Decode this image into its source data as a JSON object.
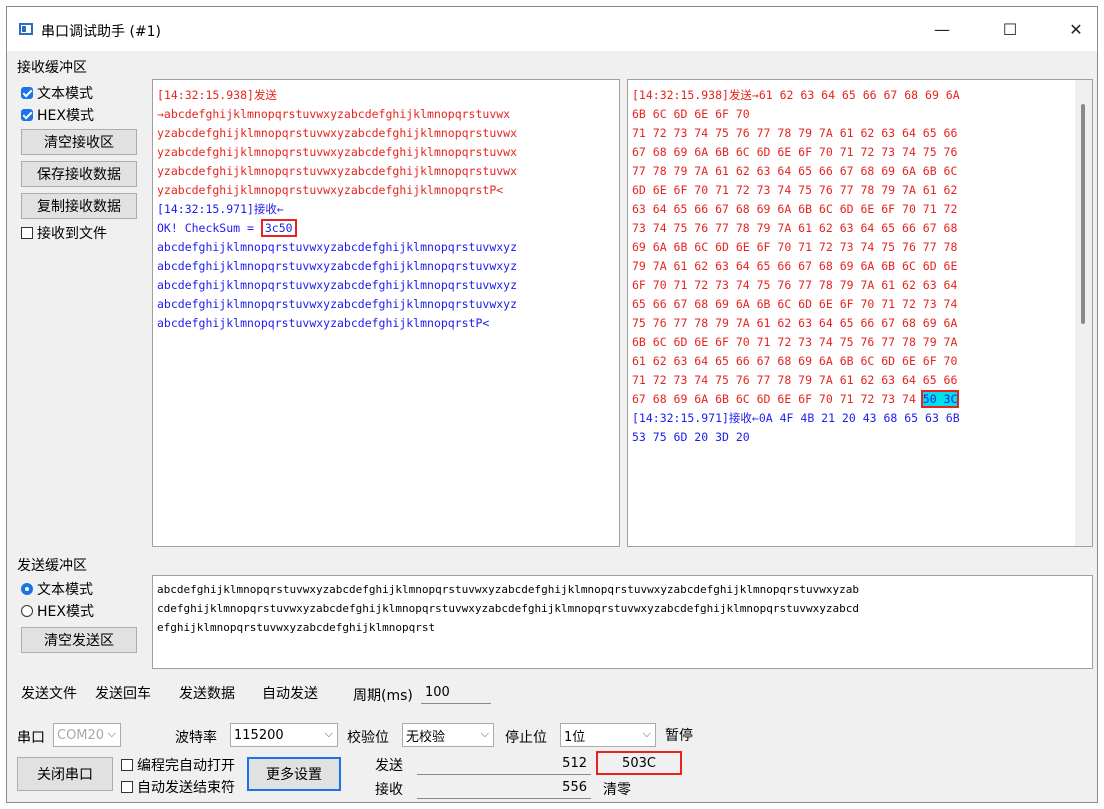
{
  "window": {
    "title": "串口调试助手 (#1)",
    "min_label": "—",
    "max_label": "☐",
    "close_label": "✕"
  },
  "receive": {
    "section_label": "接收缓冲区",
    "text_mode": "文本模式",
    "hex_mode": "HEX模式",
    "clear_btn": "清空接收区",
    "save_btn": "保存接收数据",
    "copy_btn": "复制接收数据",
    "to_file": "接收到文件",
    "text_panel": {
      "sent_header": "[14:32:15.938]发送",
      "sent_lines": [
        "→abcdefghijklmnopqrstuvwxyzabcdefghijklmnopqrstuvwx",
        "yzabcdefghijklmnopqrstuvwxyzabcdefghijklmnopqrstuvwx",
        "yzabcdefghijklmnopqrstuvwxyzabcdefghijklmnopqrstuvwx",
        "yzabcdefghijklmnopqrstuvwxyzabcdefghijklmnopqrstuvwx",
        "yzabcdefghijklmnopqrstuvwxyzabcdefghijklmnopqrstP<"
      ],
      "recv_header": "[14:32:15.971]接收←",
      "checksum_prefix": "OK! CheckSum = ",
      "checksum_value": "3c50",
      "recv_lines": [
        "abcdefghijklmnopqrstuvwxyzabcdefghijklmnopqrstuvwxyz",
        "abcdefghijklmnopqrstuvwxyzabcdefghijklmnopqrstuvwxyz",
        "abcdefghijklmnopqrstuvwxyzabcdefghijklmnopqrstuvwxyz",
        "abcdefghijklmnopqrstuvwxyzabcdefghijklmnopqrstuvwxyz",
        "abcdefghijklmnopqrstuvwxyzabcdefghijklmnopqrstP<"
      ]
    },
    "hex_panel": {
      "sent_header": "[14:32:15.938]发送→61 62 63 64 65 66 67 68 69 6A",
      "sent_lines": [
        "6B 6C 6D 6E 6F 70",
        "71 72 73 74 75 76 77 78 79 7A 61 62 63 64 65 66",
        "67 68 69 6A 6B 6C 6D 6E 6F 70 71 72 73 74 75 76",
        "77 78 79 7A 61 62 63 64 65 66 67 68 69 6A 6B 6C",
        "6D 6E 6F 70 71 72 73 74 75 76 77 78 79 7A 61 62",
        "63 64 65 66 67 68 69 6A 6B 6C 6D 6E 6F 70 71 72",
        "73 74 75 76 77 78 79 7A 61 62 63 64 65 66 67 68",
        "69 6A 6B 6C 6D 6E 6F 70 71 72 73 74 75 76 77 78",
        "79 7A 61 62 63 64 65 66 67 68 69 6A 6B 6C 6D 6E",
        "6F 70 71 72 73 74 75 76 77 78 79 7A 61 62 63 64",
        "65 66 67 68 69 6A 6B 6C 6D 6E 6F 70 71 72 73 74",
        "75 76 77 78 79 7A 61 62 63 64 65 66 67 68 69 6A",
        "6B 6C 6D 6E 6F 70 71 72 73 74 75 76 77 78 79 7A",
        "61 62 63 64 65 66 67 68 69 6A 6B 6C 6D 6E 6F 70",
        "71 72 73 74 75 76 77 78 79 7A 61 62 63 64 65 66"
      ],
      "last_prefix": "67 68 69 6A 6B 6C 6D 6E 6F 70 71 72 73 74 ",
      "last_highlight": "50 3C",
      "recv_header": "[14:32:15.971]接收←0A 4F 4B 21 20 43 68 65 63 6B",
      "recv_lines": [
        "53 75 6D 20 3D 20"
      ]
    }
  },
  "send": {
    "section_label": "发送缓冲区",
    "text_mode": "文本模式",
    "hex_mode": "HEX模式",
    "clear_btn": "清空发送区",
    "content_lines": [
      "abcdefghijklmnopqrstuvwxyzabcdefghijklmnopqrstuvwxyzabcdefghijklmnopqrstuvwxyzabcdefghijklmnopqrstuvwxyzab",
      "cdefghijklmnopqrstuvwxyzabcdefghijklmnopqrstuvwxyzabcdefghijklmnopqrstuvwxyzabcdefghijklmnopqrstuvwxyzabcd",
      "efghijklmnopqrstuvwxyzabcdefghijklmnopqrst"
    ]
  },
  "toolbar": {
    "send_file": "发送文件",
    "send_enter": "发送回车",
    "send_data": "发送数据",
    "auto_send": "自动发送",
    "period_label": "周期(ms)",
    "period_value": "100"
  },
  "port": {
    "port_label": "串口",
    "port_value": "COM20",
    "baud_label": "波特率",
    "baud_value": "115200",
    "parity_label": "校验位",
    "parity_value": "无校验",
    "stop_label": "停止位",
    "stop_value": "1位",
    "pause_btn": "暂停",
    "close_port_btn": "关闭串口",
    "auto_open": "编程完自动打开",
    "auto_send_end": "自动发送结束符",
    "more_settings": "更多设置",
    "send_label": "发送",
    "send_count": "512",
    "checksum_result": "503C",
    "recv_label": "接收",
    "recv_count": "556",
    "clear_count_btn": "清零"
  },
  "colors": {
    "sent": "#e8231f",
    "recv": "#1c1cf0",
    "highlight_bg": "#00e0e8",
    "checkbox": "#1a73e8"
  }
}
